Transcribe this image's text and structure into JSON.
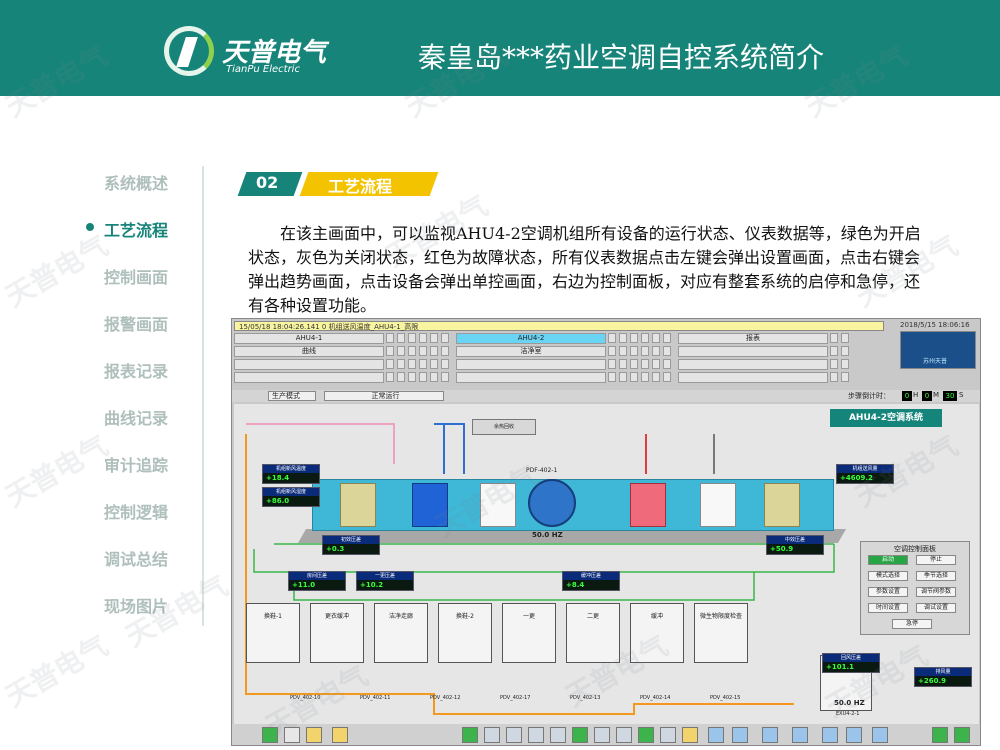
{
  "header": {
    "logo_cn": "天普电气",
    "logo_en": "TianPu Electric",
    "title": "秦皇岛***药业空调自控系统简介"
  },
  "nav": {
    "items": [
      "系统概述",
      "工艺流程",
      "控制画面",
      "报警画面",
      "报表记录",
      "曲线记录",
      "审计追踪",
      "控制逻辑",
      "调试总结",
      "现场图片"
    ],
    "active_index": 1
  },
  "section": {
    "number": "02",
    "title": "工艺流程"
  },
  "description": "在该主画面中，可以监视AHU4-2空调机组所有设备的运行状态、仪表数据等，绿色为开启状态，灰色为关闭状态，红色为故障状态，所有仪表数据点击左键会弹出设置画面，点击右键会弹出趋势画面，点击设备会弹出单控画面，右边为控制面板，对应有整套系统的启停和急停，还有各种设置功能。",
  "scada": {
    "alarm_text": "15/05/18 18:04:26.141 0  机组送风温度_AHU4-1_高限",
    "clock": "2018/5/15 18:06:16",
    "nav_row1": [
      "AHU4-1",
      "AHU4-2",
      "报表"
    ],
    "nav_row2": [
      "曲线",
      "洁净室",
      ""
    ],
    "selected_nav": "AHU4-2",
    "logo_text": "苏州天普",
    "mode_label": "生产模式",
    "status_text": "正常运行",
    "countdown_label": "步骤倒计时：",
    "countdown": [
      "0",
      "0",
      "30"
    ],
    "countdown_unit": [
      "H",
      "M",
      "S"
    ],
    "system_title": "AHU4-2空调系统",
    "fan_freq": "50.0 HZ",
    "fan_tag": "PDF-402-1",
    "instruments": [
      {
        "label": "机组新风温度",
        "value": "+18.4"
      },
      {
        "label": "机组新风湿度",
        "value": "+86.0"
      },
      {
        "label": "机组送风量",
        "value": "+4609.2"
      },
      {
        "label": "初效压差",
        "value": "+0.3"
      },
      {
        "label": "中效压差",
        "value": "+50.9"
      },
      {
        "label": "房间压差",
        "value": "+11.0"
      },
      {
        "label": "一更压差",
        "value": "+10.2"
      },
      {
        "label": "缓冲压差",
        "value": "+8.4"
      },
      {
        "label": "回风压差",
        "value": "+101.1"
      },
      {
        "label": "排风量",
        "value": "+260.9"
      }
    ],
    "control_panel": {
      "title": "空调控制面板",
      "buttons": [
        "启动",
        "停止",
        "模式选择",
        "季节选择",
        "参数设置",
        "调节阀参数",
        "时间设置",
        "调试设置",
        "急停"
      ]
    },
    "rooms": [
      "换鞋-1",
      "更衣缓冲",
      "洁净走廊",
      "换鞋-2",
      "一更",
      "二更",
      "缓冲",
      "微生物限度检查"
    ],
    "valves": [
      "PDV_402-10",
      "PDV_402-11",
      "PDV_402-12",
      "PDV_402-17",
      "PDV_402-13",
      "PDV_402-14",
      "PDV_402-15"
    ],
    "exhaust_freq": "50.0 HZ",
    "exhaust_tag": "EXU4-2-1"
  },
  "watermark": "天普电气",
  "colors": {
    "teal": "#17847a",
    "yellow": "#f4c300",
    "duct": "#3fb8d8"
  }
}
